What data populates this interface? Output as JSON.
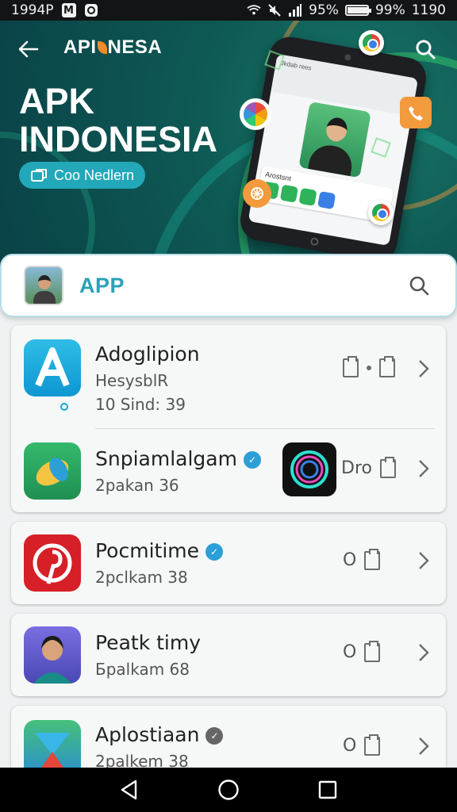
{
  "status_bar": {
    "time_left": "1994P",
    "right_text_1": "95%",
    "right_text_2": "99%",
    "right_text_3": "1190"
  },
  "hero": {
    "brand": {
      "part1": "API",
      "part2": "NESA"
    },
    "title_line1": "APK",
    "title_line2": "INDONESIA",
    "cta_label": "Coo Nedlern",
    "phone_header": "Jkdab rees",
    "phone_card_title": "Arostsnt",
    "accent_color": "#22a8b8",
    "background_color": "#0e5a55"
  },
  "search": {
    "label": "APP"
  },
  "apps": [
    {
      "name": "Adoglipion",
      "sub1": "HesysblR",
      "sub2": "10 Sind: 39",
      "icon": "letter-a-icon",
      "action_text": ""
    },
    {
      "name": "Snpiamlalgam",
      "sub1": "2pakan 36",
      "icon": "ring-app-icon",
      "verified": true,
      "action_text": "Dro"
    },
    {
      "name": "Pocmitime",
      "sub1": "2pclkam 38",
      "icon": "pinterest-icon",
      "verified": true,
      "action_text": "O"
    },
    {
      "name": "Peatk timy",
      "sub1": "Бpalkam 68",
      "icon": "portrait-icon",
      "action_text": "O"
    },
    {
      "name": "Aplostiaan",
      "sub1": "2palkem 38",
      "icon": "funnel-app-icon",
      "verified": true,
      "action_text": "O"
    }
  ],
  "nav": {
    "back": "back-icon",
    "home": "home-icon",
    "recents": "recents-icon"
  }
}
